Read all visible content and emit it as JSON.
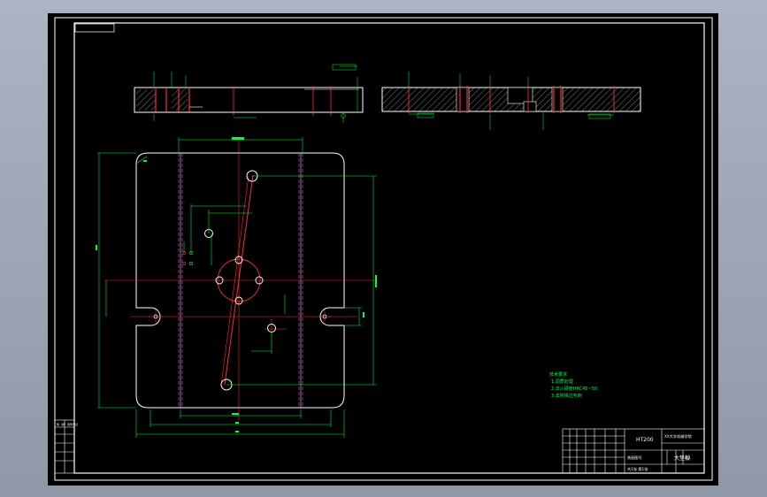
{
  "window": {
    "background": "#000000",
    "chrome_gradient": [
      "#aab4c2",
      "#8e98a6"
    ]
  },
  "colors": {
    "outline": "#ffffff",
    "dimension": "#00ff3c",
    "centerline": "#ff2a2a",
    "hidden": "#d040d0",
    "hatch": "#dddddd"
  },
  "technical_notes": {
    "title": "技术要求",
    "lines": [
      "1.调质处理",
      "2.淬火硬度HRC45~50",
      "3.去除锐边毛刺"
    ]
  },
  "title_block": {
    "material": "HT200",
    "part_name": "大垫板",
    "school": "XX大学机械学院",
    "drawing_label": "装配图号",
    "scale": "1:1",
    "sheet": "共1张 第1张"
  },
  "left_stamp": {
    "label": "借（通）用件登记"
  }
}
